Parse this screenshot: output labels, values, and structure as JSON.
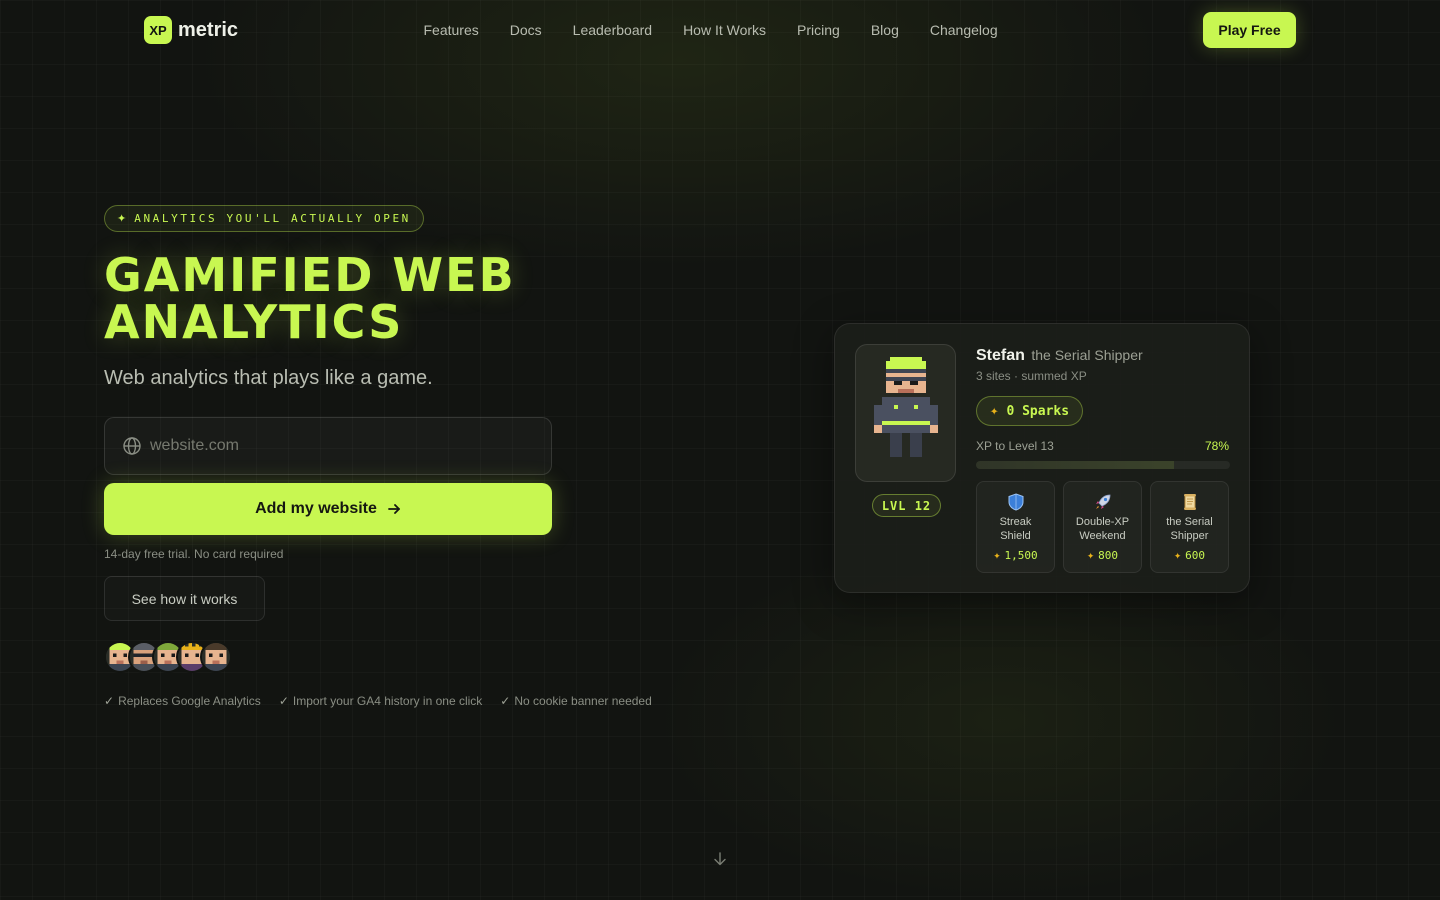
{
  "nav": {
    "logo_badge": "XP",
    "logo_text": "metric",
    "links": [
      "Features",
      "Docs",
      "Leaderboard",
      "How It Works",
      "Pricing",
      "Blog",
      "Changelog"
    ],
    "cta": "Play Free"
  },
  "hero": {
    "tag_icon": "sparkle-icon",
    "tag": "ANALYTICS YOU'LL ACTUALLY OPEN",
    "headline_line1": "GAMIFIED WEB",
    "headline_line2": "ANALYTICS",
    "subhead": "Web analytics that plays like a game.",
    "input_placeholder": "website.com",
    "input_value": "",
    "add_button": "Add my website",
    "trial_note": "14-day free trial. No card required",
    "see_button": "See how it works",
    "checks": [
      "Replaces Google Analytics",
      "Import your GA4 history in one click",
      "No cookie banner needed"
    ],
    "check_mark": "✓"
  },
  "card": {
    "name": "Stefan",
    "title": "the Serial Shipper",
    "sub": "3 sites · summed XP",
    "level_badge": "LVL 12",
    "sparks": "0 Sparks",
    "xp_label": "XP to Level 13",
    "xp_percent_label": "78%",
    "xp_percent": 78,
    "items": [
      {
        "name_l1": "Streak",
        "name_l2": "Shield",
        "cost": "1,500",
        "icon": "shield-icon"
      },
      {
        "name_l1": "Double-XP",
        "name_l2": "Weekend",
        "cost": "800",
        "icon": "rocket-icon"
      },
      {
        "name_l1": "the Serial",
        "name_l2": "Shipper",
        "cost": "600",
        "icon": "scroll-icon"
      }
    ]
  },
  "colors": {
    "accent": "#c8f751",
    "background": "#121411",
    "spark": "#e9b21a"
  }
}
